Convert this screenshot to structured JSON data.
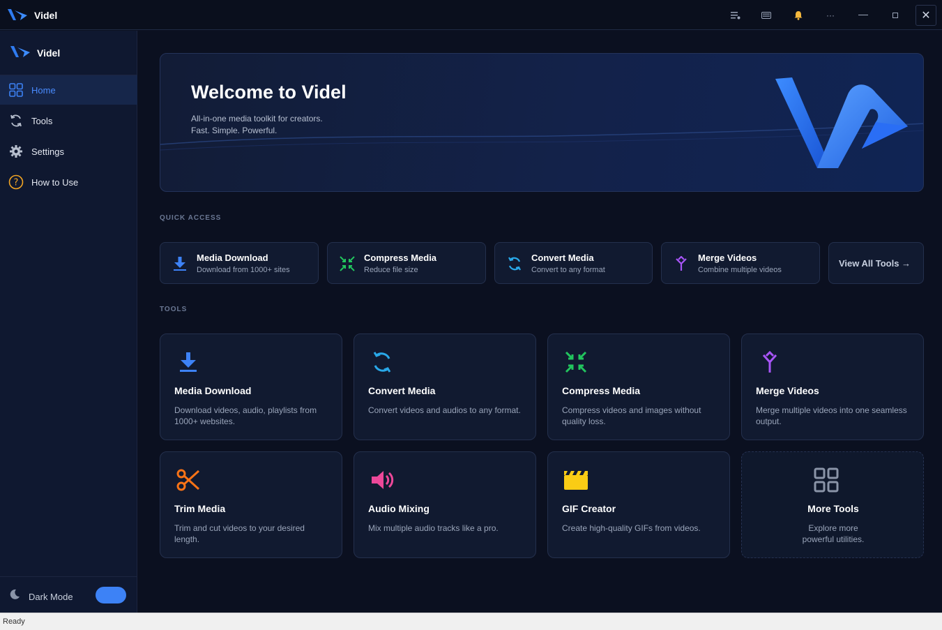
{
  "titlebar": {
    "app_name": "Videl",
    "buttons": [
      "list-icon",
      "keyboard-icon",
      "bell-icon",
      "more-icon",
      "minimize-icon",
      "maximize-icon",
      "close-icon"
    ]
  },
  "sidebar": {
    "brand": "Videl",
    "items": [
      {
        "label": "Home",
        "icon": "grid-icon",
        "active": true
      },
      {
        "label": "Tools",
        "icon": "sync-icon",
        "active": false
      },
      {
        "label": "Settings",
        "icon": "gear-icon",
        "active": false
      },
      {
        "label": "How to Use",
        "icon": "help-icon",
        "active": false
      }
    ],
    "dark_mode_label": "Dark Mode",
    "dark_mode_on": true
  },
  "hero": {
    "title": "Welcome to Videl",
    "subtitle_1": "All-in-one media toolkit for creators.",
    "subtitle_2": "Fast. Simple. Powerful."
  },
  "quick_access": {
    "heading": "QUICK ACCESS",
    "items": [
      {
        "title": "Media Download",
        "desc": "Download from 1000+ sites",
        "icon": "download-icon",
        "color": "#3d82f6"
      },
      {
        "title": "Compress Media",
        "desc": "Reduce file size",
        "icon": "compress-icon",
        "color": "#22c55e"
      },
      {
        "title": "Convert Media",
        "desc": "Convert to any format",
        "icon": "convert-icon",
        "color": "#29a8e8"
      },
      {
        "title": "Merge Videos",
        "desc": "Combine multiple videos",
        "icon": "merge-icon",
        "color": "#a855f7"
      }
    ],
    "view_all": "View All Tools →"
  },
  "tools": {
    "heading": "TOOLS",
    "items": [
      {
        "title": "Media Download",
        "desc": "Download videos, audio, playlists from 1000+ websites.",
        "icon": "download-icon",
        "color": "#3d82f6"
      },
      {
        "title": "Convert Media",
        "desc": "Convert videos and audios to any format.",
        "icon": "convert-icon",
        "color": "#29a8e8"
      },
      {
        "title": "Compress Media",
        "desc": "Compress videos and images without quality loss.",
        "icon": "compress-icon",
        "color": "#22c55e"
      },
      {
        "title": "Merge Videos",
        "desc": "Merge multiple videos into one seamless output.",
        "icon": "merge-icon",
        "color": "#a855f7"
      },
      {
        "title": "Trim Media",
        "desc": "Trim and cut videos to your desired length.",
        "icon": "scissors-icon",
        "color": "#f97316"
      },
      {
        "title": "Audio Mixing",
        "desc": "Mix multiple audio tracks like a pro.",
        "icon": "speaker-icon",
        "color": "#ec4899"
      },
      {
        "title": "GIF Creator",
        "desc": "Create high-quality GIFs from videos.",
        "icon": "clapper-icon",
        "color": "#facc15"
      },
      {
        "title": "More Tools",
        "desc": "Explore more powerful utilities.",
        "icon": "grid-icon",
        "color": "#8a94a8"
      }
    ]
  },
  "status": "Ready"
}
